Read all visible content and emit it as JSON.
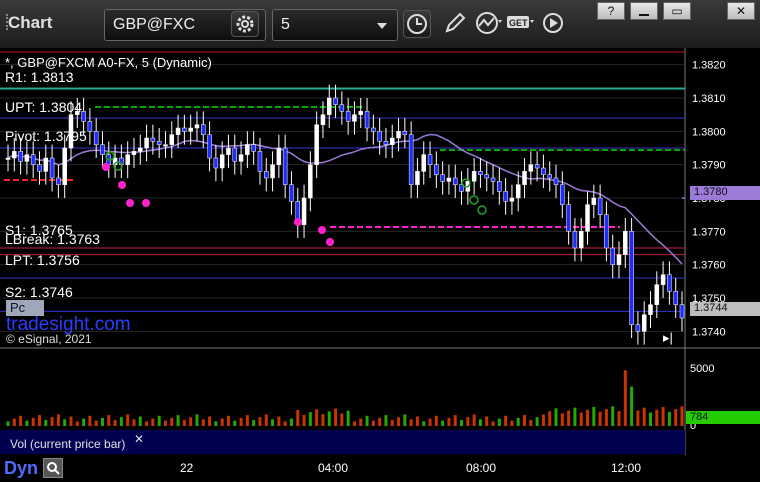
{
  "toolbar": {
    "title": "Chart",
    "symbol": "GBP@FXC",
    "interval": "5",
    "window_buttons": [
      "?",
      "▭",
      "✕"
    ]
  },
  "legend": {
    "symbol_line": "*, GBP@FXCM A0-FX, 5 (Dynamic)",
    "r1": "R1: 1.3813",
    "upt": "UPT: 1.3804",
    "pivot": "Pivot: 1.3795",
    "s1": "S1: 1.3765",
    "lbreak": "LBreak: 1.3763",
    "lpt": "LPT: 1.3756",
    "s2": "S2: 1.3746",
    "pc": "Pc",
    "watermark": "tradesight.com",
    "copyright": "© eSignal, 2021"
  },
  "volume_pane": {
    "label": "Vol (current price bar)",
    "current": "784",
    "axis_max": "5000",
    "axis_min": "0"
  },
  "bottom": {
    "mode": "Dyn",
    "time_labels": [
      "22",
      "04:00",
      "08:00",
      "12:00"
    ]
  },
  "colors": {
    "candle": "#1e2cff",
    "level_line": "#3333cc",
    "ma": "#9b7ad8",
    "green_dash": "#00aa00",
    "red_dash": "#ff2222",
    "magenta": "#ff22cc",
    "volume": "#cc3300"
  },
  "chart_data": {
    "type": "candlestick",
    "ylim": [
      1.3735,
      1.3825
    ],
    "ticks": [
      "1.3820",
      "1.3810",
      "1.3800",
      "1.3790",
      "1.3780",
      "1.3770",
      "1.3760",
      "1.3750",
      "1.3740"
    ],
    "price_labels": {
      "ma": "1.3780",
      "last": "1.3744"
    },
    "levels": [
      {
        "name": "R1",
        "value": 1.3813
      },
      {
        "name": "UPT",
        "value": 1.3804
      },
      {
        "name": "Pivot",
        "value": 1.3795
      },
      {
        "name": "S1",
        "value": 1.3765
      },
      {
        "name": "LBreak",
        "value": 1.3763
      },
      {
        "name": "LPT",
        "value": 1.3756
      },
      {
        "name": "S2",
        "value": 1.3746
      }
    ],
    "close": [
      1.3792,
      1.3794,
      1.3791,
      1.3793,
      1.379,
      1.3788,
      1.3792,
      1.3786,
      1.3784,
      1.3795,
      1.3805,
      1.3806,
      1.3803,
      1.38,
      1.3796,
      1.3793,
      1.379,
      1.3792,
      1.379,
      1.3793,
      1.3794,
      1.3795,
      1.3798,
      1.3797,
      1.3796,
      1.3796,
      1.3799,
      1.3801,
      1.38,
      1.3801,
      1.3802,
      1.3799,
      1.3792,
      1.3789,
      1.3793,
      1.3795,
      1.3791,
      1.3793,
      1.3796,
      1.3794,
      1.3788,
      1.3786,
      1.379,
      1.3795,
      1.3784,
      1.3779,
      1.3772,
      1.378,
      1.379,
      1.3802,
      1.3805,
      1.381,
      1.3808,
      1.3806,
      1.3803,
      1.3805,
      1.3806,
      1.3801,
      1.38,
      1.3797,
      1.3796,
      1.3798,
      1.38,
      1.3799,
      1.3784,
      1.3788,
      1.3793,
      1.379,
      1.3787,
      1.3785,
      1.3786,
      1.3784,
      1.3782,
      1.3785,
      1.3788,
      1.3787,
      1.3786,
      1.3785,
      1.3782,
      1.3779,
      1.378,
      1.3784,
      1.3788,
      1.379,
      1.3789,
      1.3787,
      1.3786,
      1.3784,
      1.3778,
      1.377,
      1.3765,
      1.377,
      1.3778,
      1.378,
      1.3775,
      1.3765,
      1.376,
      1.3763,
      1.377,
      1.3742,
      1.374,
      1.3745,
      1.3748,
      1.3754,
      1.3757,
      1.3752,
      1.3748,
      1.3744
    ],
    "volume_max": 5000
  }
}
